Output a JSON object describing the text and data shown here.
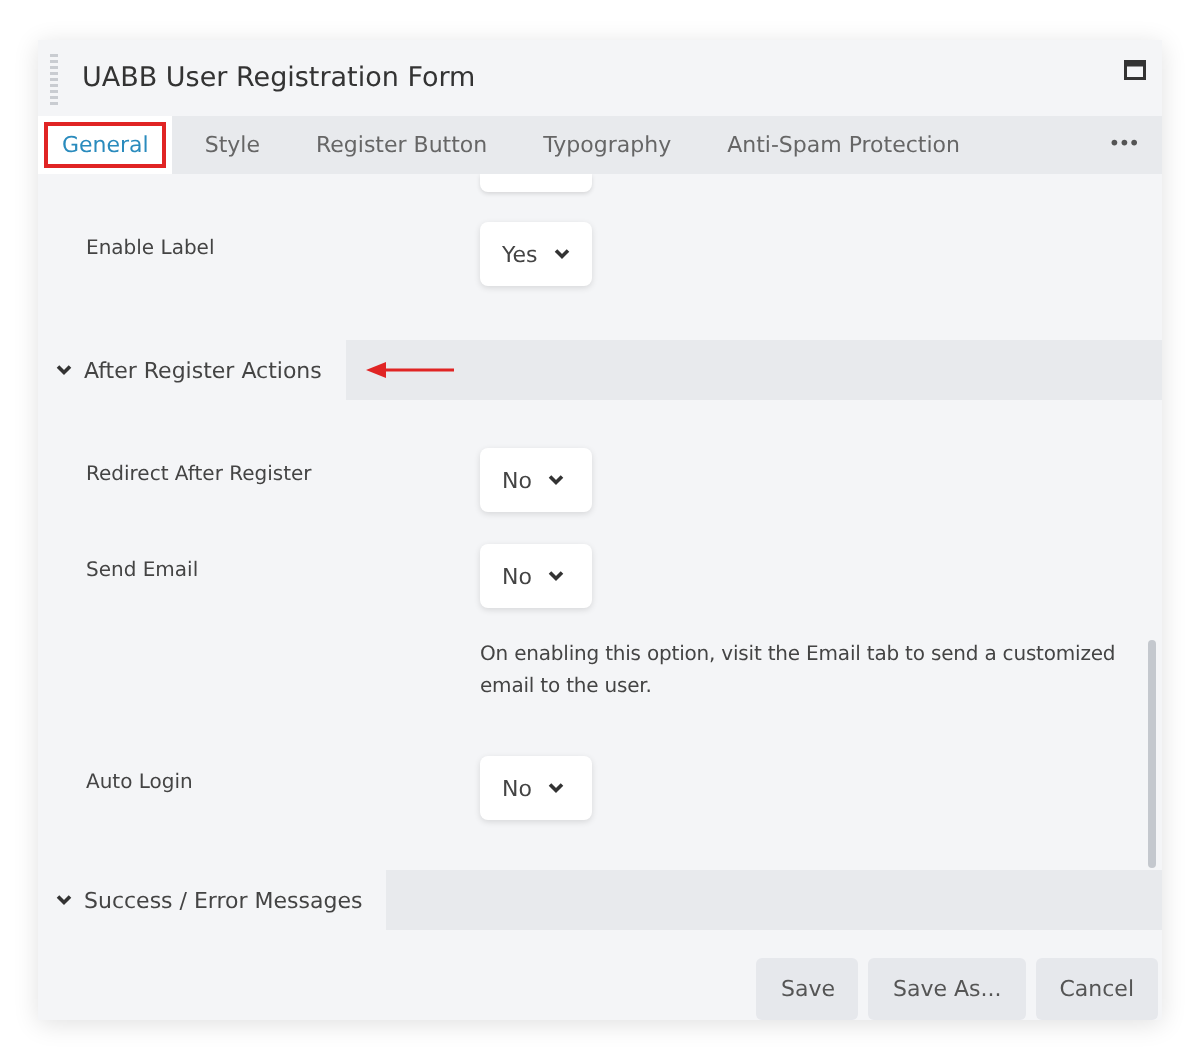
{
  "window": {
    "title": "UABB User Registration Form"
  },
  "tabs": [
    {
      "label": "General",
      "selected": true,
      "highlighted": true
    },
    {
      "label": "Style",
      "selected": false,
      "highlighted": false
    },
    {
      "label": "Register Button",
      "selected": false,
      "highlighted": false
    },
    {
      "label": "Typography",
      "selected": false,
      "highlighted": false
    },
    {
      "label": "Anti-Spam Protection",
      "selected": false,
      "highlighted": false
    }
  ],
  "more_tabs": "•••",
  "sections": [
    {
      "kind": "fields",
      "fields": [
        {
          "label": "Enable Label",
          "value": "Yes"
        }
      ]
    },
    {
      "kind": "group",
      "title": "After Register Actions",
      "expanded": true,
      "pointer_arrow": true,
      "fields": [
        {
          "label": "Redirect After Register",
          "value": "No"
        },
        {
          "label": "Send Email",
          "value": "No",
          "help": "On enabling this option, visit the Email tab to send a customized email to the user."
        },
        {
          "label": "Auto Login",
          "value": "No"
        }
      ]
    },
    {
      "kind": "group",
      "title": "Success / Error Messages",
      "expanded": true,
      "pointer_arrow": false
    }
  ],
  "buttons": [
    "Save",
    "Save As...",
    "Cancel"
  ]
}
